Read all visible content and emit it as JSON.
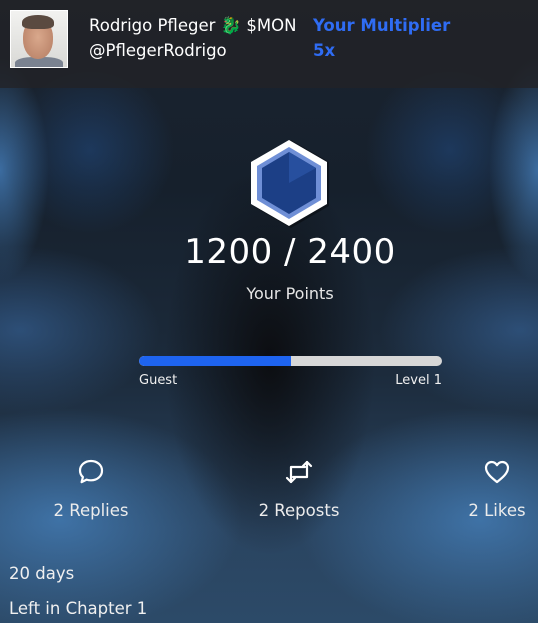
{
  "user": {
    "display_name": "Rodrigo Pfleger 🐉 $MON",
    "handle": "@PflegerRodrigo"
  },
  "multiplier": {
    "label": "Your Multiplier",
    "value": "5x"
  },
  "points": {
    "display": "1200 / 2400",
    "label": "Your Points",
    "current": 1200,
    "max": 2400
  },
  "progress": {
    "fraction": 0.5,
    "start_label": "Guest",
    "end_label": "Level 1"
  },
  "stats": {
    "replies": "2 Replies",
    "reposts": "2 Reposts",
    "likes": "2 Likes"
  },
  "chapter": {
    "days": "20 days",
    "left_label": "Left in Chapter 1"
  },
  "colors": {
    "accent": "#2f6cf3",
    "progress_fill": "#1e64f0",
    "progress_track": "#d7d7d7"
  },
  "icons": {
    "level_badge": "hexagon-badge-icon",
    "replies": "speech-bubble-icon",
    "reposts": "repost-arrows-icon",
    "likes": "heart-icon"
  }
}
